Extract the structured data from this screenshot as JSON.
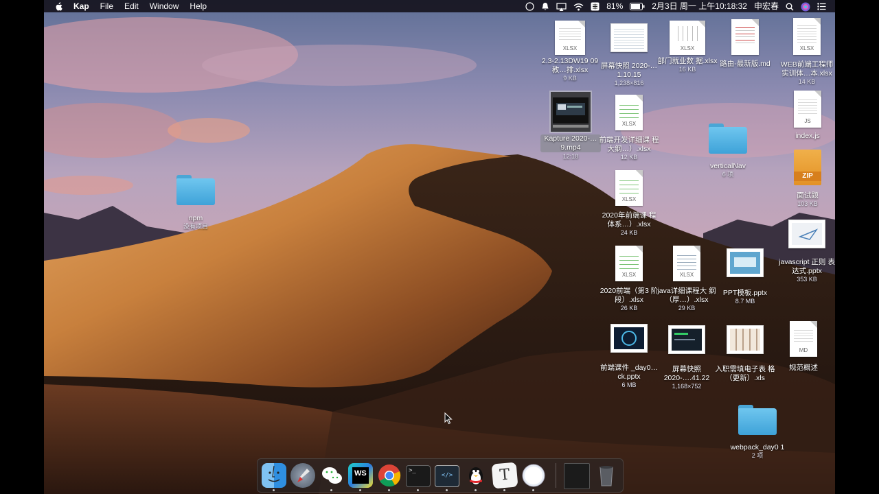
{
  "menubar": {
    "app_name": "Kap",
    "menus": [
      "File",
      "Edit",
      "Window",
      "Help"
    ],
    "battery": "81%",
    "clock": "2月3日 周一 上午10:18:32",
    "user": "申宏春"
  },
  "desktop": {
    "items": [
      {
        "name": "2.3-2.13DW19 09教…排.xlsx",
        "sub": "9 KB",
        "kind": "xlsx"
      },
      {
        "name": "屏幕快照 2020-…1.10.15",
        "sub": "1,238×816",
        "kind": "screenshot"
      },
      {
        "name": "部门就业数 据.xlsx",
        "sub": "16 KB",
        "kind": "xlsx"
      },
      {
        "name": "路由-最新版.md",
        "sub": "",
        "kind": "md"
      },
      {
        "name": "WEB前端工程师 实训体…本.xlsx",
        "sub": "14 KB",
        "kind": "xlsx"
      },
      {
        "name": "Kapture 2020-…9.mp4",
        "sub": "12:18",
        "kind": "video"
      },
      {
        "name": "前端开发详细课 程大纲…）.xlsx",
        "sub": "12 KB",
        "kind": "xlsx"
      },
      {
        "name": "verticalNav",
        "sub": "6 项",
        "kind": "folder"
      },
      {
        "name": "index.js",
        "sub": "",
        "kind": "js"
      },
      {
        "name": "面试题",
        "sub": "103 KB",
        "kind": "zip"
      },
      {
        "name": "npm",
        "sub": "没有项目",
        "kind": "folder"
      },
      {
        "name": "2020年前端课 程体系…）.xlsx",
        "sub": "24 KB",
        "kind": "xlsx"
      },
      {
        "name": "javascript 正则 表达式.pptx",
        "sub": "353 KB",
        "kind": "pptx"
      },
      {
        "name": "2020前端（第3 阶段）.xlsx",
        "sub": "26 KB",
        "kind": "xlsx"
      },
      {
        "name": "java详细课程大 纲（厚…）.xlsx",
        "sub": "29 KB",
        "kind": "xlsx"
      },
      {
        "name": "PPT模板.pptx",
        "sub": "8.7 MB",
        "kind": "pptx"
      },
      {
        "name": "前端课件 _day0…ck.pptx",
        "sub": "6 MB",
        "kind": "pptx"
      },
      {
        "name": "屏幕快照 2020-….41.22",
        "sub": "1,168×752",
        "kind": "screenshot"
      },
      {
        "name": "入职需填电子表 格（更新）.xls",
        "sub": "",
        "kind": "xls"
      },
      {
        "name": "规范概述",
        "sub": "",
        "kind": "md"
      },
      {
        "name": "webpack_day0 1",
        "sub": "2 项",
        "kind": "folder"
      }
    ]
  },
  "dock": {
    "apps": [
      "finder-icon",
      "launchpad-icon",
      "wechat-icon",
      "webstorm-icon",
      "chrome-icon",
      "terminal-icon",
      "code-icon",
      "qq-icon",
      "typora-icon",
      "kap-icon",
      "minimized-window",
      "trash-icon"
    ]
  },
  "colors": {
    "folder": "#4aa6d6",
    "menubar": "#16141e"
  }
}
